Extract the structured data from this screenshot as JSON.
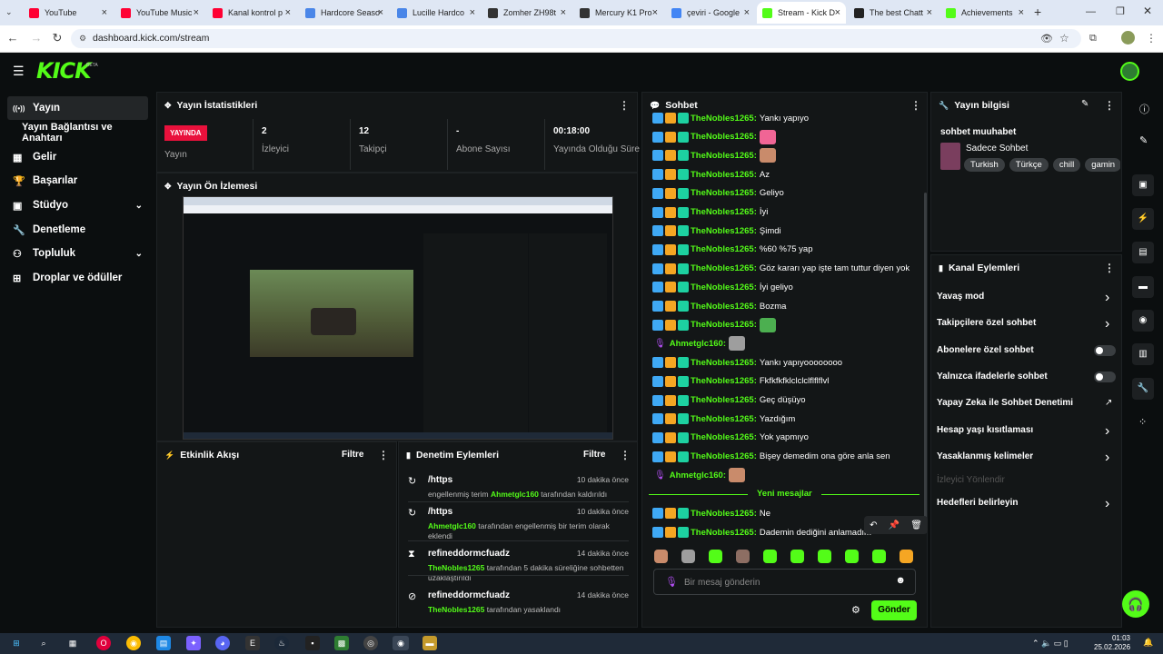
{
  "browser": {
    "tabs": [
      {
        "title": "YouTube",
        "color": "#ff0033"
      },
      {
        "title": "YouTube Music",
        "color": "#ff0033"
      },
      {
        "title": "Kanal kontrol p",
        "color": "#ff0033"
      },
      {
        "title": "Hardcore Seaso",
        "color": "#4a86e8"
      },
      {
        "title": "Lucille Hardco",
        "color": "#4a86e8"
      },
      {
        "title": "Zomher ZH98t",
        "color": "#333333"
      },
      {
        "title": "Mercury K1 Pro",
        "color": "#333333"
      },
      {
        "title": "çeviri - Google",
        "color": "#4285f4"
      },
      {
        "title": "Stream - Kick D",
        "color": "#53fc18"
      },
      {
        "title": "The best Chatt",
        "color": "#222222"
      },
      {
        "title": "Achievements",
        "color": "#53fc18"
      }
    ],
    "url": "dashboard.kick.com/stream"
  },
  "app": {
    "logo": "KICK",
    "beta": "BETA"
  },
  "sidebar": {
    "items": [
      {
        "label": "Yayın",
        "icon": "broadcast-icon"
      },
      {
        "label": "Yayın Bağlantısı ve Anahtarı",
        "icon": ""
      },
      {
        "label": "Gelir",
        "icon": "money-icon"
      },
      {
        "label": "Başarılar",
        "icon": "trophy-icon"
      },
      {
        "label": "Stüdyo",
        "icon": "studio-icon"
      },
      {
        "label": "Denetleme",
        "icon": "wrench-icon"
      },
      {
        "label": "Topluluk",
        "icon": "community-icon"
      },
      {
        "label": "Droplar ve ödüller",
        "icon": "gift-icon"
      }
    ]
  },
  "stats": {
    "title": "Yayın İstatistikleri",
    "badge": "YAYINDA",
    "status_label": "Yayın",
    "items": [
      {
        "value": "2",
        "label": "İzleyici"
      },
      {
        "value": "12",
        "label": "Takipçi"
      },
      {
        "value": "-",
        "label": "Abone Sayısı"
      },
      {
        "value": "00:18:00",
        "label": "Yayında Olduğu Süre"
      }
    ]
  },
  "preview": {
    "title": "Yayın Ön İzlemesi"
  },
  "activity": {
    "title": "Etkinlik Akışı",
    "filter": "Filtre"
  },
  "modlog": {
    "title": "Denetim Eylemleri",
    "filter": "Filtre",
    "entries": [
      {
        "title": "/https",
        "time": "10 dakika önce",
        "pre": "engellenmiş terim",
        "user": "Ahmetglc160",
        "post": "tarafından kaldırıldı"
      },
      {
        "title": "/https",
        "time": "10 dakika önce",
        "pre": "",
        "user": "Ahmetglc160",
        "post": "tarafından engellenmiş bir terim olarak eklendi"
      },
      {
        "title": "refineddormcfuadz",
        "time": "14 dakika önce",
        "pre": "",
        "user": "TheNobles1265",
        "post": "tarafından 5 dakika süreliğine sohbetten uzaklaştırıldı"
      },
      {
        "title": "refineddormcfuadz",
        "time": "14 dakika önce",
        "pre": "",
        "user": "TheNobles1265",
        "post": "tarafından yasaklandı"
      }
    ]
  },
  "chat": {
    "title": "Sohbet",
    "messages": [
      {
        "user": "TheNobles1265",
        "text": "Yankı yapıyo",
        "emote": ""
      },
      {
        "user": "TheNobles1265",
        "text": "",
        "emote": "#f06595"
      },
      {
        "user": "TheNobles1265",
        "text": "",
        "emote": "#c98b6b"
      },
      {
        "user": "TheNobles1265",
        "text": "Az",
        "emote": ""
      },
      {
        "user": "TheNobles1265",
        "text": "Geliyo",
        "emote": ""
      },
      {
        "user": "TheNobles1265",
        "text": "İyi",
        "emote": ""
      },
      {
        "user": "TheNobles1265",
        "text": "Şimdi",
        "emote": ""
      },
      {
        "user": "TheNobles1265",
        "text": "%60 %75 yap",
        "emote": ""
      },
      {
        "user": "TheNobles1265",
        "text": "Göz kararı yap işte tam tuttur diyen yok",
        "emote": ""
      },
      {
        "user": "TheNobles1265",
        "text": "İyi geliyo",
        "emote": ""
      },
      {
        "user": "TheNobles1265",
        "text": "Bozma",
        "emote": ""
      },
      {
        "user": "TheNobles1265",
        "text": "",
        "emote": "#4caf50"
      },
      {
        "user": "Ahmetglc160",
        "text": "",
        "emote": "#9e9e9e"
      },
      {
        "user": "TheNobles1265",
        "text": "Yankı yapıyoooooooo",
        "emote": ""
      },
      {
        "user": "TheNobles1265",
        "text": "Fkfkfkfklclclclflflflvl",
        "emote": ""
      },
      {
        "user": "TheNobles1265",
        "text": "Geç düşüyo",
        "emote": ""
      },
      {
        "user": "TheNobles1265",
        "text": "Yazdığım",
        "emote": ""
      },
      {
        "user": "TheNobles1265",
        "text": "Yok yapmıyo",
        "emote": ""
      },
      {
        "user": "TheNobles1265",
        "text": "Bişey demedim ona göre anla sen",
        "emote": ""
      },
      {
        "user": "Ahmetglc160",
        "text": "",
        "emote": "#c98b6b"
      }
    ],
    "new_label": "Yeni mesajlar",
    "new_messages": [
      {
        "user": "TheNobles1265",
        "text": "Ne"
      },
      {
        "user": "TheNobles1265",
        "text": "Dademin dediğini anlamadım"
      }
    ],
    "input_placeholder": "Bir mesaj gönderin",
    "send": "Gönder"
  },
  "info": {
    "title": "Yayın bilgisi",
    "stream_title": "sohbet muuhabet",
    "category": "Sadece Sohbet",
    "tags": [
      "Turkish",
      "Türkçe",
      "chill",
      "gamin"
    ]
  },
  "actions": {
    "title": "Kanal Eylemleri",
    "items": [
      {
        "label": "Yavaş mod",
        "ctrl": "arrow"
      },
      {
        "label": "Takipçilere özel sohbet",
        "ctrl": "arrow"
      },
      {
        "label": "Abonelere özel sohbet",
        "ctrl": "toggle"
      },
      {
        "label": "Yalnızca ifadelerle sohbet",
        "ctrl": "toggle"
      },
      {
        "label": "Yapay Zeka ile Sohbet Denetimi",
        "ctrl": "ext"
      },
      {
        "label": "Hesap yaşı kısıtlaması",
        "ctrl": "arrow"
      },
      {
        "label": "Yasaklanmış kelimeler",
        "ctrl": "arrow"
      },
      {
        "label": "İzleyici Yönlendir",
        "ctrl": "none"
      },
      {
        "label": "Hedefleri belirleyin",
        "ctrl": "arrow"
      }
    ]
  },
  "taskbar": {
    "time": "01:03",
    "date": "25.02.2026"
  }
}
